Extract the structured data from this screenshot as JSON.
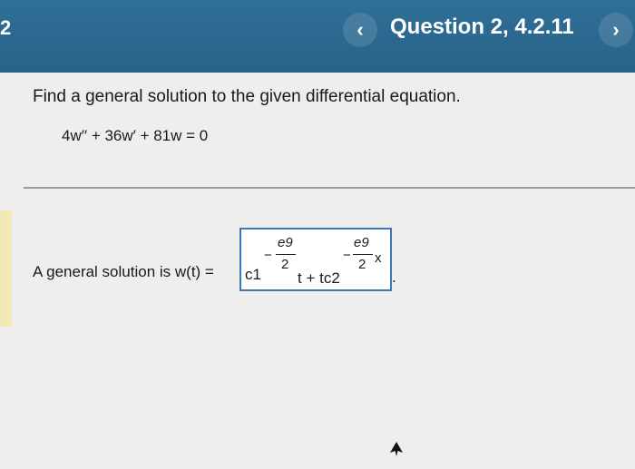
{
  "header": {
    "question_number": "2",
    "title": "Question 2, 4.2.11",
    "prev_icon": "‹",
    "next_icon": "›"
  },
  "problem": {
    "prompt": "Find a general solution to the given differential equation.",
    "equation": "4w′′ + 36w′ + 81w = 0"
  },
  "answer": {
    "label": "A general solution is w(t) =",
    "c1": "c1",
    "exp1_sign": "−",
    "exp1_numerator": "e9",
    "exp1_denominator": "2",
    "middle": "t + tc2",
    "exp2_sign": "−",
    "exp2_numerator": "e9",
    "exp2_denominator": "2",
    "exp2_variable": "x",
    "trailing": "."
  },
  "colors": {
    "header": "#2f6f98",
    "answer_border": "#3c79b4",
    "page": "#eeeeec"
  }
}
